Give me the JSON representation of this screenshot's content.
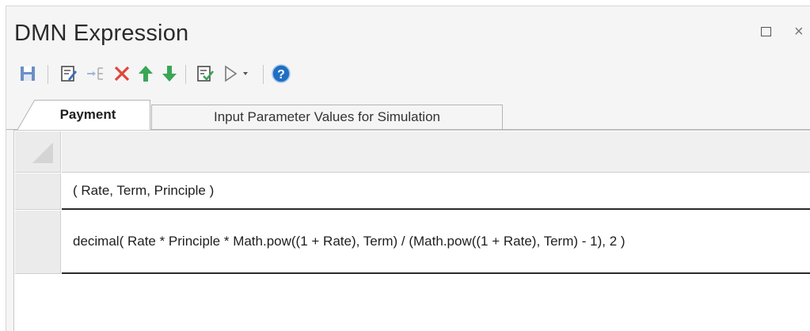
{
  "window": {
    "title": "DMN Expression"
  },
  "toolbar": {
    "buttons": [
      {
        "name": "save",
        "icon": "save-icon"
      },
      {
        "name": "edit-properties",
        "icon": "edit-icon"
      },
      {
        "name": "insert",
        "icon": "insert-icon"
      },
      {
        "name": "delete",
        "icon": "delete-icon"
      },
      {
        "name": "move-up",
        "icon": "arrow-up-icon"
      },
      {
        "name": "move-down",
        "icon": "arrow-down-icon"
      },
      {
        "name": "validate",
        "icon": "validate-icon"
      },
      {
        "name": "run",
        "icon": "play-icon"
      },
      {
        "name": "run-options",
        "icon": "dropdown-icon"
      },
      {
        "name": "help",
        "icon": "help-icon"
      }
    ]
  },
  "tabs": [
    {
      "label": "Payment",
      "active": true
    },
    {
      "label": "Input Parameter Values for Simulation",
      "active": false
    }
  ],
  "grid": {
    "rows": [
      {
        "text": "( Rate, Term, Principle )"
      },
      {
        "text": "decimal( Rate * Principle * Math.pow((1 + Rate), Term) / (Math.pow((1 + Rate), Term) - 1), 2 )"
      }
    ]
  },
  "colors": {
    "save": "#6b8fc7",
    "delete": "#e0463c",
    "arrow_up": "#3aa656",
    "arrow_down": "#3aa656",
    "help": "#1f6fc2"
  }
}
